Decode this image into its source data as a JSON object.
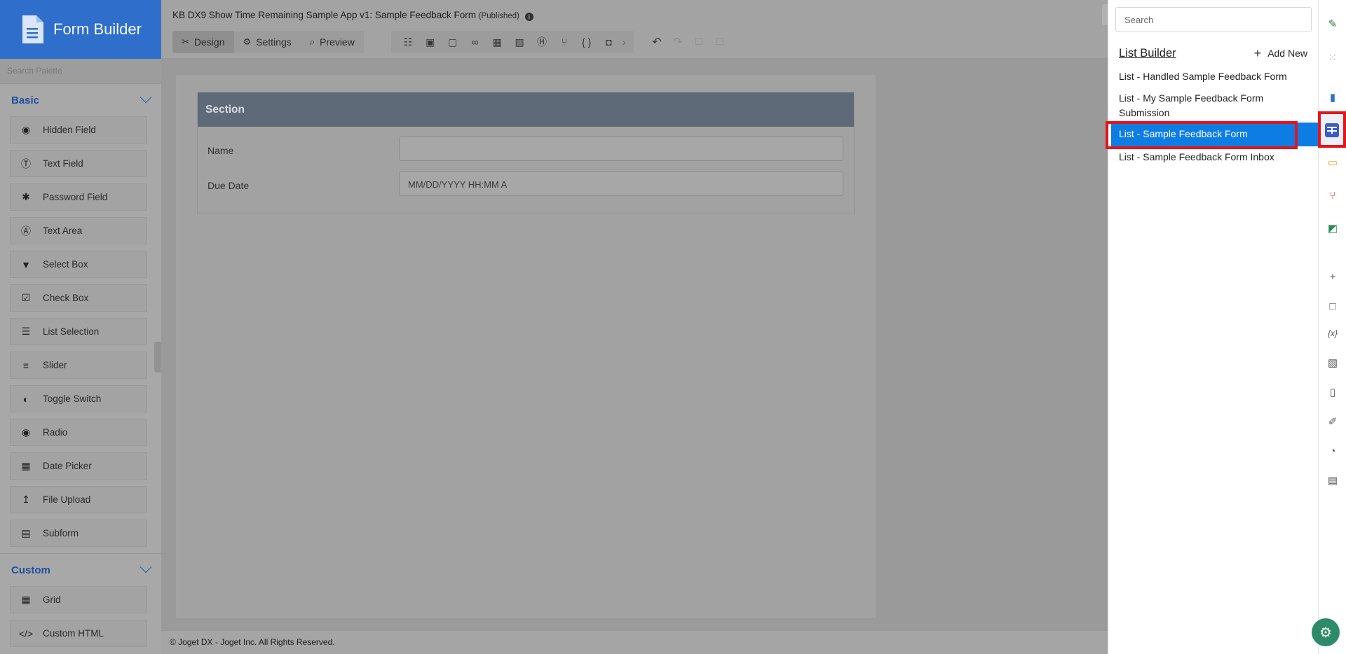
{
  "app": {
    "name": "Form Builder"
  },
  "header": {
    "title": "KB DX9 Show Time Remaining Sample App v1: Sample Feedback Form",
    "status": "(Published)",
    "tabs": [
      {
        "label": "Design",
        "icon": "design-icon",
        "active": true
      },
      {
        "label": "Settings",
        "icon": "gear-icon",
        "active": false
      },
      {
        "label": "Preview",
        "icon": "preview-icon",
        "active": false
      }
    ]
  },
  "palette": {
    "search_placeholder": "Search Palette",
    "groups": [
      {
        "label": "Basic",
        "items": [
          {
            "label": "Hidden Field",
            "icon": "eye-slash-icon"
          },
          {
            "label": "Text Field",
            "icon": "text-field-icon"
          },
          {
            "label": "Password Field",
            "icon": "asterisk-icon"
          },
          {
            "label": "Text Area",
            "icon": "text-area-icon"
          },
          {
            "label": "Select Box",
            "icon": "select-box-icon"
          },
          {
            "label": "Check Box",
            "icon": "checkbox-icon"
          },
          {
            "label": "List Selection",
            "icon": "list-icon"
          },
          {
            "label": "Slider",
            "icon": "slider-icon"
          },
          {
            "label": "Toggle Switch",
            "icon": "toggle-icon"
          },
          {
            "label": "Radio",
            "icon": "radio-icon"
          },
          {
            "label": "Date Picker",
            "icon": "calendar-icon"
          },
          {
            "label": "File Upload",
            "icon": "upload-icon"
          },
          {
            "label": "Subform",
            "icon": "subform-icon"
          }
        ]
      },
      {
        "label": "Custom",
        "items": [
          {
            "label": "Grid",
            "icon": "grid-icon"
          },
          {
            "label": "Custom HTML",
            "icon": "code-icon"
          }
        ]
      }
    ]
  },
  "form": {
    "section_title": "Section",
    "fields": [
      {
        "label": "Name",
        "value": ""
      },
      {
        "label": "Due Date",
        "placeholder": "MM/DD/YYYY HH:MM A"
      }
    ]
  },
  "footer": {
    "text": "© Joget DX - Joget Inc. All Rights Reserved."
  },
  "flyout": {
    "search_placeholder": "Search",
    "heading": "List Builder",
    "add_new_label": "Add New",
    "items": [
      {
        "label": "List - Handled Sample Feedback Form",
        "selected": false
      },
      {
        "label": "List - My Sample Feedback Form Submission",
        "selected": false
      },
      {
        "label": "List - Sample Feedback Form",
        "selected": true
      },
      {
        "label": "List - Sample Feedback Form Inbox",
        "selected": false
      }
    ]
  },
  "colors": {
    "brand": "#2f6fcb",
    "selected": "#0d7de3",
    "highlight": "#e8121b"
  }
}
